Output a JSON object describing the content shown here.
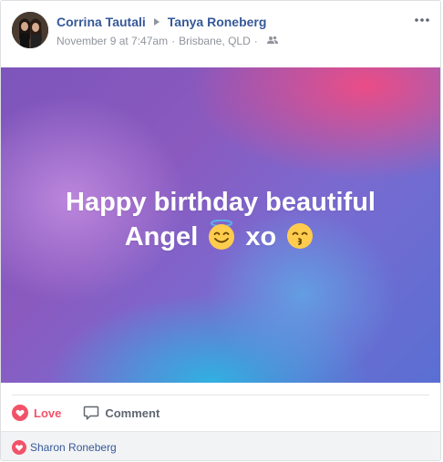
{
  "post": {
    "author": "Corrina Tautali",
    "recipient": "Tanya Roneberg",
    "timestamp": "November 9 at 7:47am",
    "separator": "·",
    "location": "Brisbane, QLD",
    "audience_icon": "friends-icon",
    "more_icon": "more-options-icon"
  },
  "banner": {
    "line1": "Happy birthday beautiful",
    "line2_word1": "Angel",
    "emoji1": "smiling-face-with-halo",
    "line2_word2": "xo",
    "emoji2": "kissing-face-with-smiling-eyes",
    "colors": {
      "pink": "#f04b82",
      "purple": "#7d55bb",
      "blue": "#2db4e1"
    }
  },
  "actions": {
    "love_label": "Love",
    "comment_label": "Comment",
    "love_color": "#f25268"
  },
  "reactions": {
    "names": "Sharon Roneberg"
  }
}
